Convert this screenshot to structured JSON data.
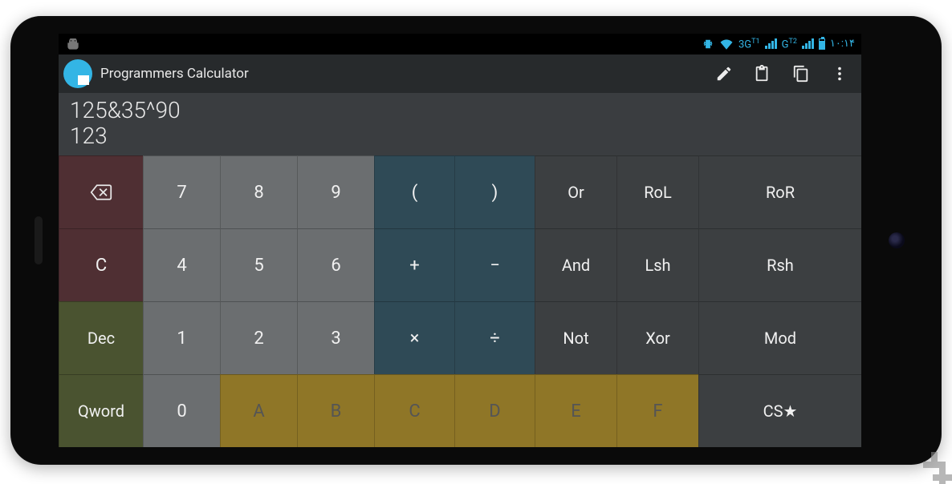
{
  "status": {
    "vibrate_icon": "vibrate",
    "wifi_icon": "wifi",
    "net1": "3G",
    "net1_sup": "T1",
    "net2": "G",
    "net2_sup": "T2",
    "time": "١٠:١۴"
  },
  "actionbar": {
    "title": "Programmers Calculator",
    "icons": {
      "edit": "pencil-icon",
      "paste": "clipboard-icon",
      "copy": "copy-icon",
      "overflow": "overflow-icon"
    }
  },
  "display": {
    "expression": "125&35^90",
    "result": "123"
  },
  "keys": {
    "backspace": "⌫",
    "clear": "C",
    "dec": "Dec",
    "qword": "Qword",
    "d7": "7",
    "d8": "8",
    "d9": "9",
    "d4": "4",
    "d5": "5",
    "d6": "6",
    "d1": "1",
    "d2": "2",
    "d3": "3",
    "d0": "0",
    "lp": "(",
    "rp": ")",
    "plus": "+",
    "minus": "−",
    "mul": "×",
    "div": "÷",
    "or": "Or",
    "rol": "RoL",
    "ror": "RoR",
    "and": "And",
    "lsh": "Lsh",
    "rsh": "Rsh",
    "not": "Not",
    "xor": "Xor",
    "mod": "Mod",
    "hA": "A",
    "hB": "B",
    "hC": "C",
    "hD": "D",
    "hE": "E",
    "hF": "F",
    "cs": "CS★"
  }
}
